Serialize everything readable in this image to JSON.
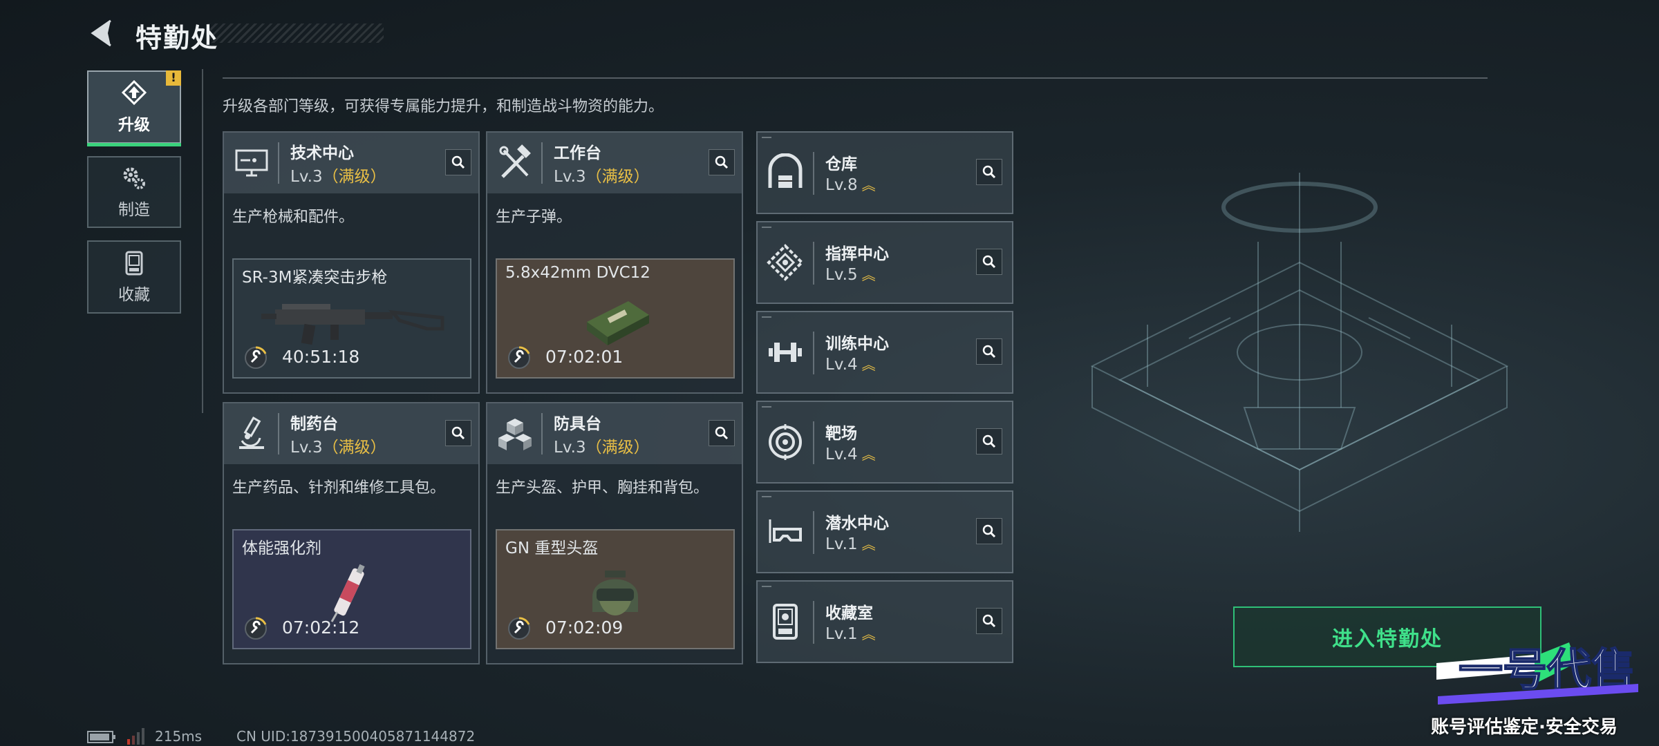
{
  "header": {
    "title": "特勤处"
  },
  "nav": {
    "items": [
      {
        "label": "升级",
        "active": true,
        "badge": "!"
      },
      {
        "label": "制造",
        "active": false
      },
      {
        "label": "收藏",
        "active": false
      }
    ]
  },
  "subtitle": "升级各部门等级，可获得专属能力提升，和制造战斗物资的能力。",
  "facilities": [
    {
      "name": "技术中心",
      "level": "Lv.3",
      "max_label": "（满级）",
      "desc": "生产枪械和配件。",
      "product": {
        "name": "SR-3M紧凑突击步枪",
        "timer": "40:51:18"
      }
    },
    {
      "name": "工作台",
      "level": "Lv.3",
      "max_label": "（满级）",
      "desc": "生产子弹。",
      "product": {
        "name": "5.8x42mm DVC12",
        "timer": "07:02:01"
      }
    },
    {
      "name": "制药台",
      "level": "Lv.3",
      "max_label": "（满级）",
      "desc": "生产药品、针剂和维修工具包。",
      "product": {
        "name": "体能强化剂",
        "timer": "07:02:12"
      }
    },
    {
      "name": "防具台",
      "level": "Lv.3",
      "max_label": "（满级）",
      "desc": "生产头盔、护甲、胸挂和背包。",
      "product": {
        "name": "GN 重型头盔",
        "timer": "07:02:09"
      }
    }
  ],
  "small_facilities": [
    {
      "name": "仓库",
      "level": "Lv.8",
      "icon": "warehouse-icon"
    },
    {
      "name": "指挥中心",
      "level": "Lv.5",
      "icon": "command-center-icon"
    },
    {
      "name": "训练中心",
      "level": "Lv.4",
      "icon": "dumbbell-icon"
    },
    {
      "name": "靶场",
      "level": "Lv.4",
      "icon": "target-icon"
    },
    {
      "name": "潜水中心",
      "level": "Lv.1",
      "icon": "diving-mask-icon"
    },
    {
      "name": "收藏室",
      "level": "Lv.1",
      "icon": "collection-icon"
    }
  ],
  "enter_button": "进入特勤处",
  "footer": {
    "ping": "215ms",
    "uid": "CN UID:1873915004058711448​72"
  },
  "watermark": {
    "logo_text": "一号代售",
    "text": "账号评估鉴定·安全交易"
  },
  "colors": {
    "accent_green": "#3fe08a",
    "max_gold": "#e9bf45",
    "alert_yellow": "#e8b93a"
  }
}
